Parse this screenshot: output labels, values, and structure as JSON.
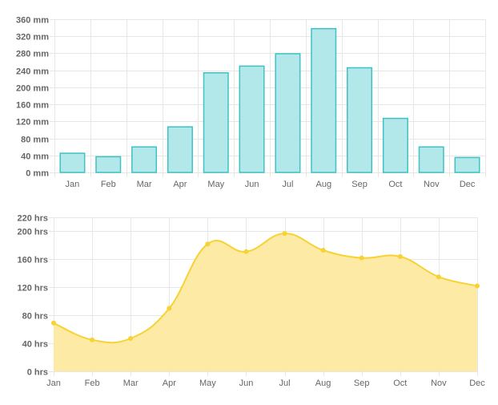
{
  "chart_data": [
    {
      "type": "bar",
      "categories": [
        "Jan",
        "Feb",
        "Mar",
        "Apr",
        "May",
        "Jun",
        "Jul",
        "Aug",
        "Sep",
        "Oct",
        "Nov",
        "Dec"
      ],
      "values": [
        45,
        37,
        60,
        107,
        234,
        250,
        279,
        338,
        246,
        127,
        60,
        35
      ],
      "y_ticks": [
        "0 mm",
        "40 mm",
        "80 mm",
        "120 mm",
        "160 mm",
        "200 mm",
        "240 mm",
        "280 mm",
        "320 mm",
        "360 mm"
      ],
      "ylim": [
        0,
        360
      ],
      "grid": true,
      "colors": {
        "fill": "#b2e8ea",
        "stroke": "#3fc1c6"
      }
    },
    {
      "type": "area",
      "categories": [
        "Jan",
        "Feb",
        "Mar",
        "Apr",
        "May",
        "Jun",
        "Jul",
        "Aug",
        "Sep",
        "Oct",
        "Nov",
        "Dec"
      ],
      "values": [
        69,
        45,
        47,
        90,
        182,
        171,
        197,
        173,
        162,
        164,
        135,
        122
      ],
      "y_ticks": [
        "0 hrs",
        "40 hrs",
        "80 hrs",
        "120 hrs",
        "160 hrs",
        "200 hrs",
        "220 hrs"
      ],
      "y_tick_values": [
        0,
        40,
        80,
        120,
        160,
        200,
        220
      ],
      "ylim": [
        0,
        220
      ],
      "grid": true,
      "colors": {
        "fill": "#fde9a0",
        "stroke": "#f7d233",
        "point": "#f7d233"
      }
    }
  ]
}
